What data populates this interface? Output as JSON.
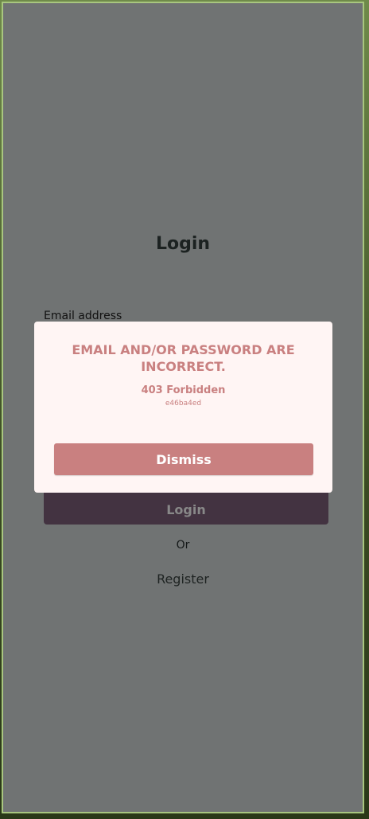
{
  "page": {
    "title": "Login",
    "email_label": "Email address",
    "login_label": "Login",
    "or_label": "Or",
    "register_label": "Register"
  },
  "dialog": {
    "title": "EMAIL AND/OR PASSWORD ARE INCORRECT.",
    "status": "403 Forbidden",
    "error_id": "e46ba4ed",
    "dismiss_label": "Dismiss"
  },
  "colors": {
    "overlay": "#707373",
    "accent": "#c98080",
    "dialog_bg": "#fff5f4",
    "login_button": "#433341"
  }
}
